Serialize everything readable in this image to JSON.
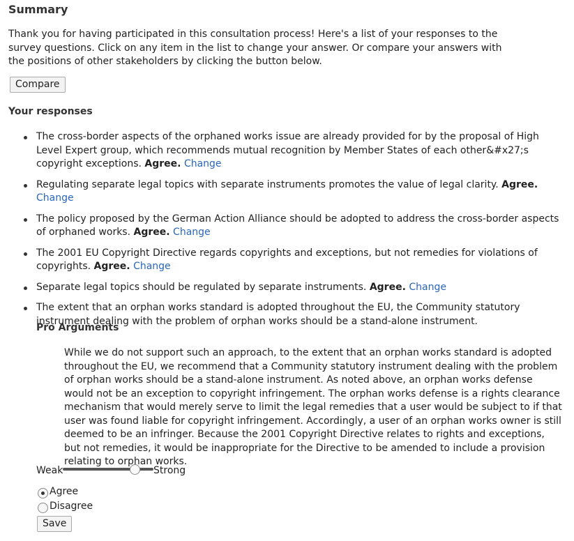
{
  "summary": {
    "title": "Summary",
    "intro": "Thank you for having participated in this consultation process! Here's a list of your responses to the survey questions. Click on any item in the list to change your answer. Or compare your answers with the positions of other stakeholders by clicking the button below.",
    "compare_label": "Compare"
  },
  "responses": {
    "heading": "Your responses",
    "change_label": "Change",
    "items": [
      {
        "text": "The cross-border aspects of the orphaned works issue are already provided for by the proposal of High Level Expert group, which recommends mutual recognition by Member States of each other&#x27;s copyright exceptions.",
        "answer": "Agree."
      },
      {
        "text": "Regulating separate legal topics with separate instruments promotes the value of legal clarity.",
        "answer": "Agree."
      },
      {
        "text": "The policy proposed by the German Action Alliance should be adopted to address the cross-border aspects of orphaned works.",
        "answer": "Agree."
      },
      {
        "text": "The 2001 EU Copyright Directive regards copyrights and exceptions, but not remedies for violations of copyrights.",
        "answer": "Agree."
      },
      {
        "text": "Separate legal topics should be regulated by separate instruments.",
        "answer": "Agree."
      },
      {
        "text": "The extent that an orphan works standard is adopted throughout the EU, the Community statutory instrument dealing with the problem of orphan works should be a stand-alone instrument."
      }
    ]
  },
  "pro": {
    "title": "Pro Arguments",
    "text": "While we do not support such an approach, to the extent that an orphan works standard is adopted throughout the EU, we recommend that a Community statutory instrument dealing with the problem of orphan works should be a stand-alone instrument. As noted above, an orphan works defense would not be an exception to copyright infringement. The orphan works defense is a rights clearance mechanism that would merely serve to limit the legal remedies that a user would be subject to if that user was found liable for copyright infringement. Accordingly, a user of an orphan works owner is still deemed to be an infringer. Because the 2001 Copyright Directive relates to rights and exceptions, but not remedies, it would be inappropriate for the Directive to be amended to include a provision relating to orphan works."
  },
  "strength": {
    "weak_label": "Weak",
    "strong_label": "Strong",
    "value": 0.82
  },
  "choice": {
    "agree_label": "Agree",
    "disagree_label": "Disagree",
    "selected": "Agree"
  },
  "save_label": "Save",
  "colors": {
    "link": "#2a67b8"
  }
}
